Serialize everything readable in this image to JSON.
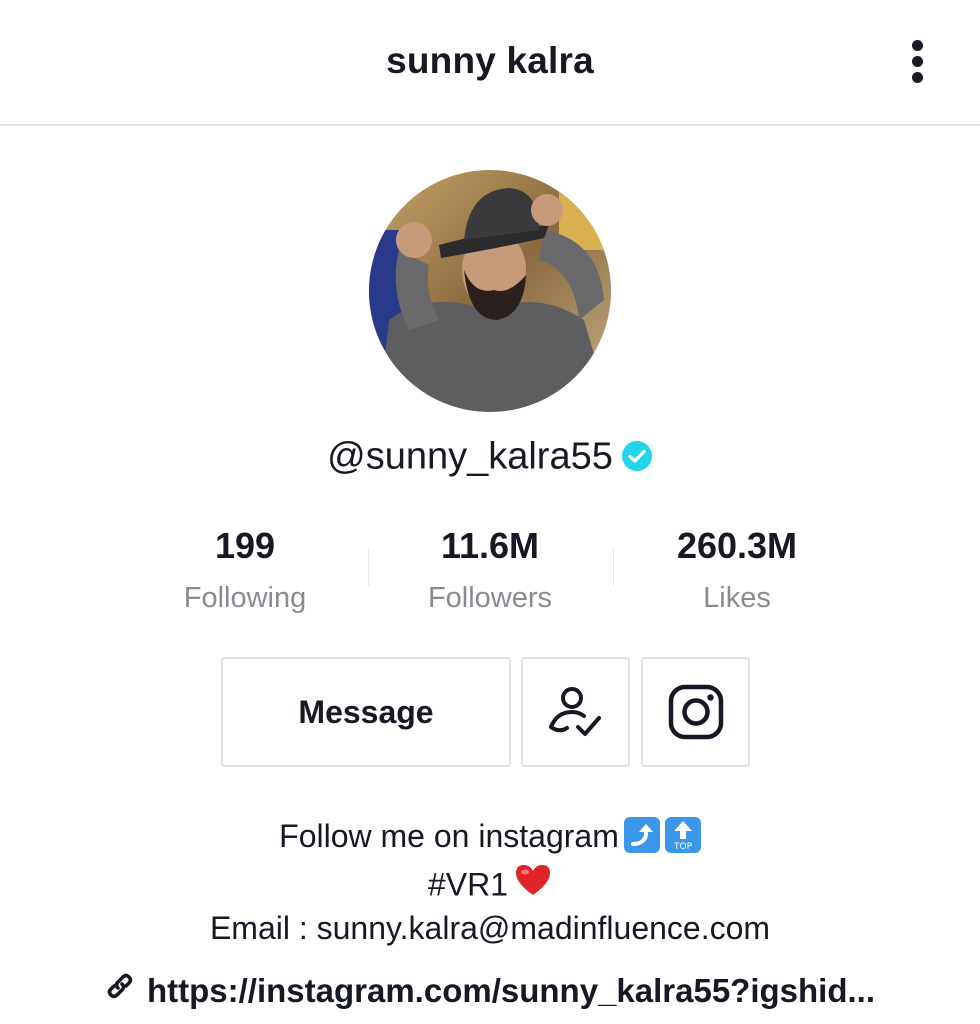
{
  "header": {
    "title": "sunny kalra",
    "more_icon": "more-vertical-icon"
  },
  "profile": {
    "avatar_icon": "profile-photo",
    "username": "@sunny_kalra55",
    "verified_icon": "verified-badge-icon",
    "verified_color": "#20d5ec"
  },
  "stats": [
    {
      "value": "199",
      "label": "Following"
    },
    {
      "value": "11.6M",
      "label": "Followers"
    },
    {
      "value": "260.3M",
      "label": "Likes"
    }
  ],
  "actions": {
    "message_label": "Message",
    "following_icon": "user-check-icon",
    "instagram_icon": "instagram-icon"
  },
  "bio": {
    "line1": "Follow me on instagram",
    "line1_emojis": [
      "right-arrow-curving-up-emoji",
      "top-arrow-emoji"
    ],
    "line2": "#VR1",
    "line2_emoji": "red-heart-emoji",
    "line3": "Email : sunny.kalra@madinfluence.com",
    "top_emoji_text": "TOP"
  },
  "link": {
    "icon": "link-icon",
    "text": "https://instagram.com/sunny_kalra55?igshid..."
  },
  "colors": {
    "text": "#161823",
    "secondary_text": "#8a8b91",
    "border": "#e0e0e1",
    "emoji_blue": "#3a97ea",
    "heart_red": "#e0242a"
  }
}
